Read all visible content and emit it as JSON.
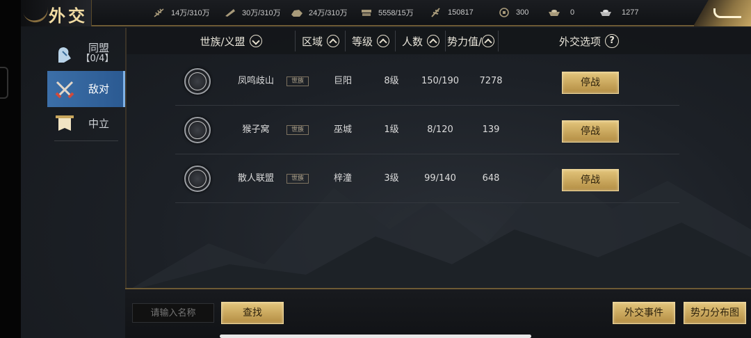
{
  "header": {
    "title": "外交",
    "resources": [
      {
        "icon": "wheat-icon",
        "value": "14万/310万"
      },
      {
        "icon": "feather-icon",
        "value": "30万/310万"
      },
      {
        "icon": "stone-icon",
        "value": "24万/310万"
      },
      {
        "icon": "iron-icon",
        "value": "5558/15万"
      },
      {
        "icon": "scroll-icon",
        "value": "150817"
      },
      {
        "icon": "copper-coin-icon",
        "value": "300"
      },
      {
        "icon": "gold-ingot-icon",
        "value": "0"
      },
      {
        "icon": "silver-ingot-icon",
        "value": "1277"
      }
    ]
  },
  "sidebar": {
    "items": [
      {
        "label": "同盟",
        "sub": "【0/4】",
        "icon": "alliance-icon",
        "active": false
      },
      {
        "label": "敌对",
        "icon": "crossed-swords-icon",
        "active": true
      },
      {
        "label": "中立",
        "icon": "banner-icon",
        "active": false
      }
    ]
  },
  "table": {
    "headers": {
      "clan": "世族/义盟",
      "region": "区域",
      "level": "等级",
      "members": "人数",
      "power": "势力值/",
      "options": "外交选项"
    },
    "rows": [
      {
        "name": "凤鸣歧山",
        "tag": "世族",
        "region": "巨阳",
        "level": "8级",
        "members": "150/190",
        "power": "7278",
        "action": "停战"
      },
      {
        "name": "猴子窝",
        "tag": "世族",
        "region": "巫城",
        "level": "1级",
        "members": "8/120",
        "power": "139",
        "action": "停战"
      },
      {
        "name": "散人联盟",
        "tag": "世族",
        "region": "梓潼",
        "level": "3级",
        "members": "99/140",
        "power": "648",
        "action": "停战"
      }
    ]
  },
  "bottom": {
    "search_placeholder": "请输入名称",
    "search_button": "查找",
    "events_button": "外交事件",
    "map_button": "势力分布图"
  },
  "colors": {
    "accent_gold": "#c9a75e",
    "active_tab": "#3c6fa8"
  }
}
